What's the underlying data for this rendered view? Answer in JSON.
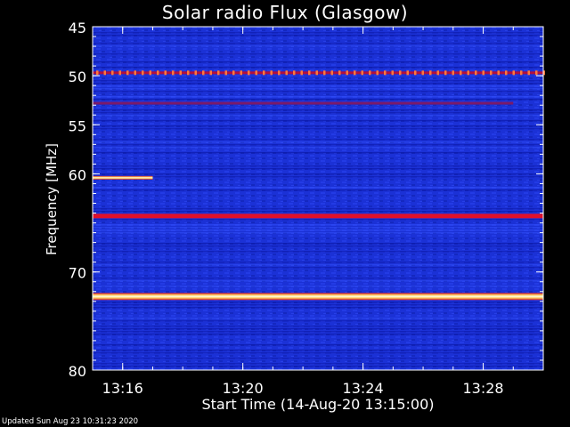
{
  "chart_data": {
    "type": "heatmap",
    "title": "Solar radio Flux (Glasgow)",
    "xlabel": "Start Time (14-Aug-20 13:15:00)",
    "ylabel": "Frequency [MHz]",
    "footer": "Updated Sun Aug 23 10:31:23 2020",
    "x_axis": {
      "unit": "minutes",
      "range": [
        "13:15",
        "13:30"
      ],
      "ticks": [
        "13:16",
        "13:20",
        "13:24",
        "13:28"
      ]
    },
    "y_axis": {
      "unit": "MHz",
      "range": [
        45,
        80
      ],
      "inverted": true,
      "ticks": [
        "45",
        "50",
        "55",
        "60",
        "70",
        "80"
      ],
      "tick_values": [
        45,
        50,
        55,
        60,
        70,
        80
      ]
    },
    "background_color": "#1a2fd0",
    "colors": {
      "low": "#0a0a8a",
      "mid": "#cc1033",
      "high": "#fff7b0",
      "axis": "#ffffff"
    },
    "emission_bands": [
      {
        "freq_mhz": 49.7,
        "start": "13:15",
        "end": "13:30",
        "intensity": "medium",
        "style": "dotted"
      },
      {
        "freq_mhz": 52.8,
        "start": "13:15",
        "end": "13:29",
        "intensity": "low-medium"
      },
      {
        "freq_mhz": 60.4,
        "start": "13:15",
        "end": "13:17",
        "intensity": "high"
      },
      {
        "freq_mhz": 64.3,
        "start": "13:15",
        "end": "13:30",
        "intensity": "medium-high"
      },
      {
        "freq_mhz": 72.5,
        "start": "13:15",
        "end": "13:30",
        "intensity": "very high"
      }
    ],
    "grid": false
  }
}
